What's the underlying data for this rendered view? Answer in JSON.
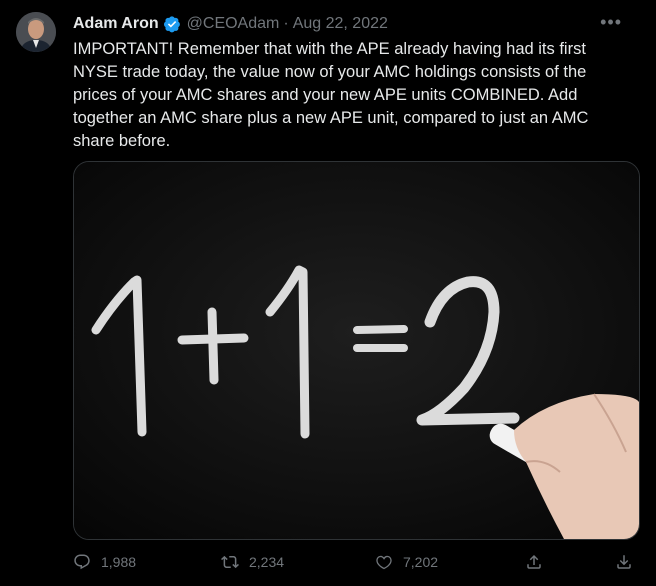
{
  "author": {
    "name": "Adam Aron",
    "handle": "@CEOAdam",
    "separator": "·",
    "date": "Aug 22, 2022",
    "verified_color": "#1d9bf0"
  },
  "tweet": {
    "text": "IMPORTANT! Remember that with the APE already having had its first NYSE trade today, the value now of your AMC holdings consists of the prices of your AMC shares and your new APE units COMBINED. Add together an AMC share plus a new APE unit, compared to just an AMC share before."
  },
  "media": {
    "chalkboard_text": "1+1=2"
  },
  "actions": {
    "replies": "1,988",
    "retweets": "2,234",
    "likes": "7,202"
  },
  "icons": [
    "more-icon",
    "verified-badge-icon",
    "reply-icon",
    "retweet-icon",
    "like-icon",
    "share-icon",
    "download-icon"
  ],
  "colors": {
    "background": "#000000",
    "text": "#e7e9ea",
    "muted": "#71767b"
  }
}
